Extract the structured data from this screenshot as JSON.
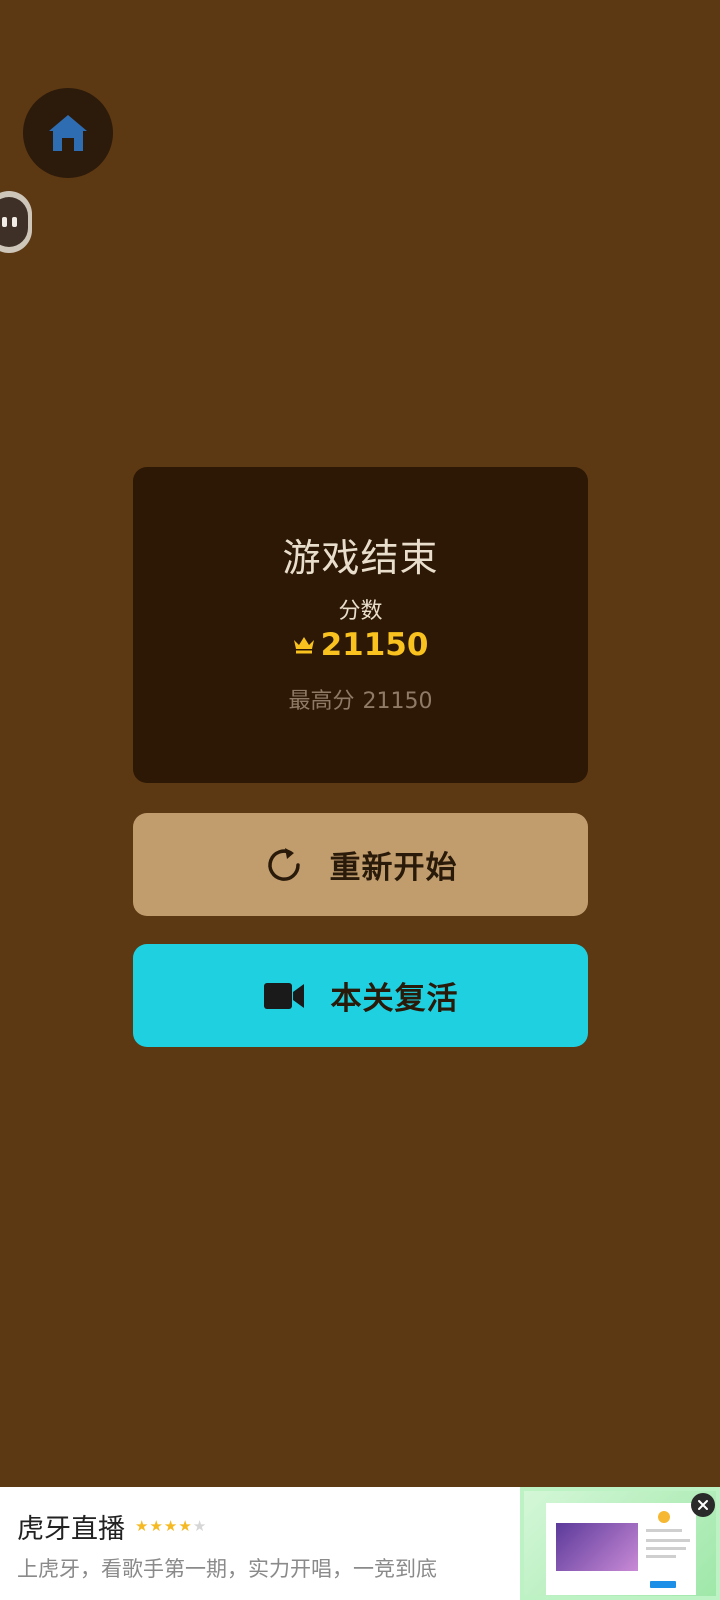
{
  "icons": {
    "home": "home-icon",
    "floating": "floating-assistant-icon",
    "crown": "crown-icon",
    "restart": "refresh-icon",
    "revive": "video-camera-icon",
    "close": "close-icon"
  },
  "colors": {
    "background": "#5c3813",
    "panel": "#2c1805",
    "score_accent": "#f9c21f",
    "restart_button": "#c19d6e",
    "revive_button": "#1fd0e0",
    "home_icon": "#2f6db3"
  },
  "result_panel": {
    "title": "游戏结束",
    "score_label": "分数",
    "score_value": "21150",
    "best_label": "最高分",
    "best_value": "21150"
  },
  "buttons": {
    "restart_label": "重新开始",
    "revive_label": "本关复活"
  },
  "ad": {
    "title": "虎牙直播",
    "rating": 4,
    "rating_max": 5,
    "description": "上虎牙，看歌手第一期，实力开唱，一竞到底"
  }
}
